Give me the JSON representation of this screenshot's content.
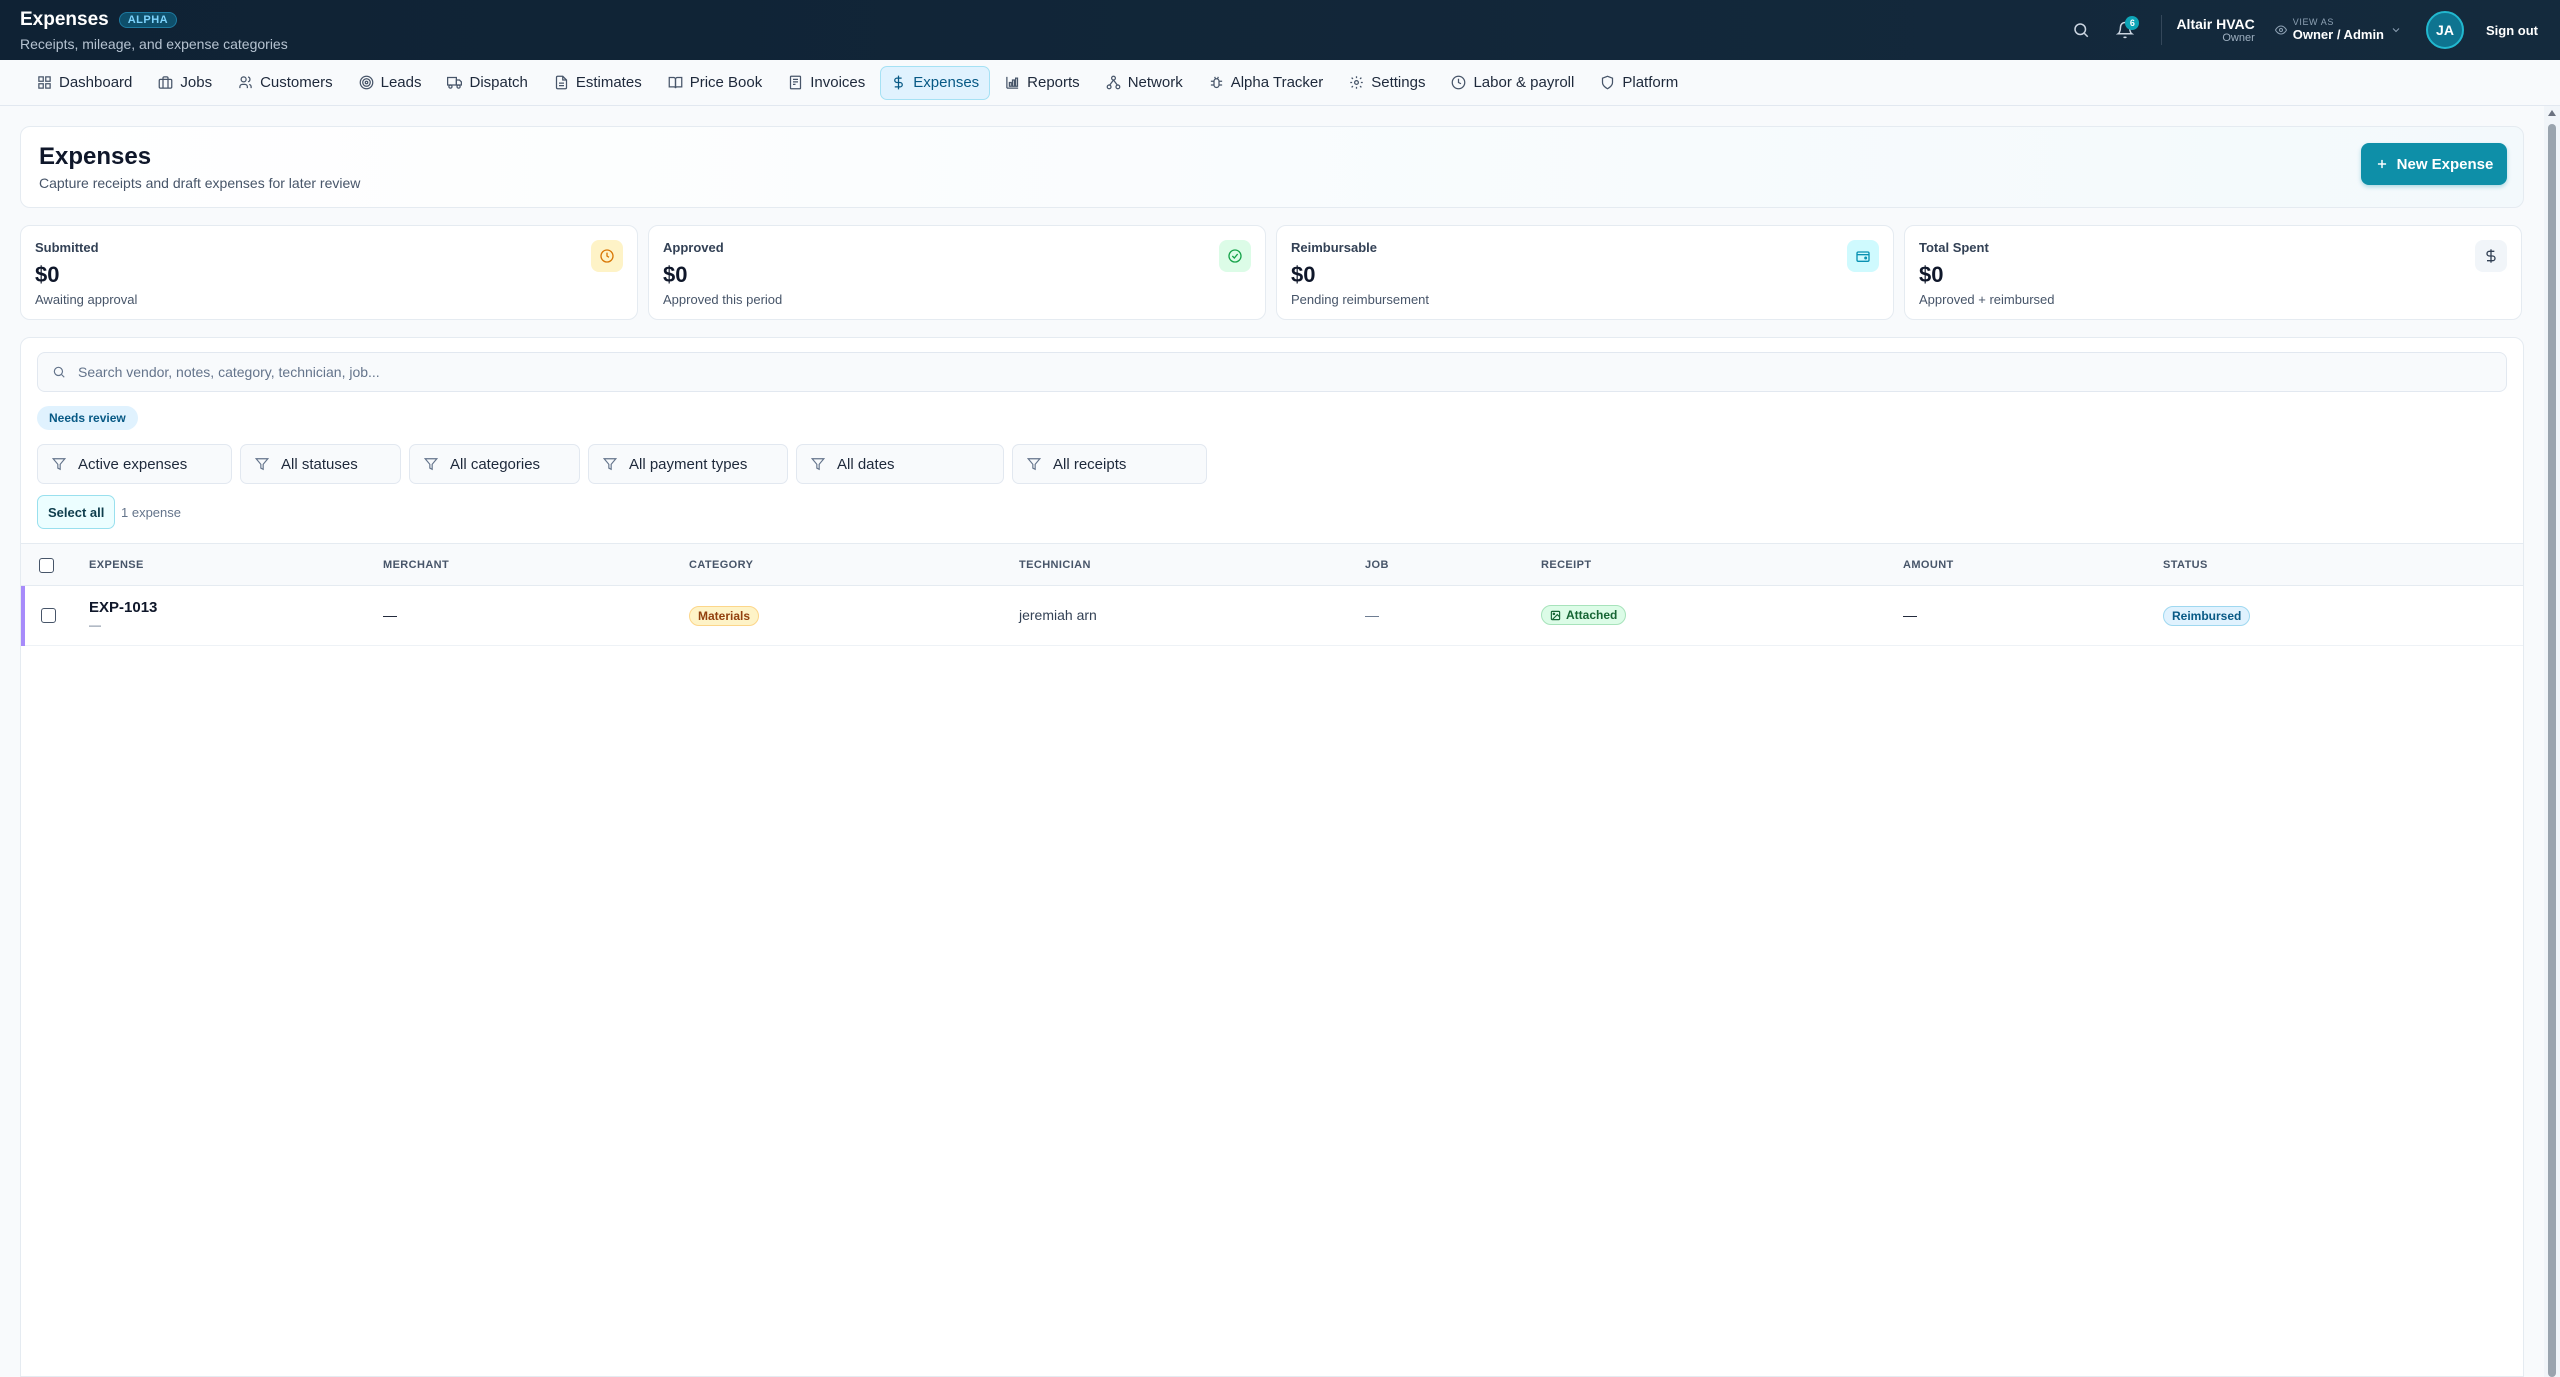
{
  "header": {
    "title": "Expenses",
    "badge": "ALPHA",
    "subtitle": "Receipts, mileage, and expense categories",
    "notifications_count": "6",
    "org_name": "Altair HVAC",
    "org_role": "Owner",
    "view_as_label": "VIEW AS",
    "view_as_value": "Owner / Admin",
    "avatar_initials": "JA",
    "signout_label": "Sign out"
  },
  "nav": {
    "items": [
      {
        "label": "Dashboard",
        "icon": "grid-icon"
      },
      {
        "label": "Jobs",
        "icon": "briefcase-icon"
      },
      {
        "label": "Customers",
        "icon": "users-icon"
      },
      {
        "label": "Leads",
        "icon": "target-icon"
      },
      {
        "label": "Dispatch",
        "icon": "truck-icon"
      },
      {
        "label": "Estimates",
        "icon": "file-icon"
      },
      {
        "label": "Price Book",
        "icon": "book-icon"
      },
      {
        "label": "Invoices",
        "icon": "receipt-icon"
      },
      {
        "label": "Expenses",
        "icon": "dollar-icon",
        "active": true
      },
      {
        "label": "Reports",
        "icon": "bar-chart-icon"
      },
      {
        "label": "Network",
        "icon": "network-icon"
      },
      {
        "label": "Alpha Tracker",
        "icon": "bug-icon"
      },
      {
        "label": "Settings",
        "icon": "gear-icon"
      },
      {
        "label": "Labor & payroll",
        "icon": "clock-icon"
      },
      {
        "label": "Platform",
        "icon": "shield-icon"
      }
    ]
  },
  "page": {
    "title": "Expenses",
    "subtitle": "Capture receipts and draft expenses for later review",
    "new_button": "New Expense"
  },
  "stats": [
    {
      "label": "Submitted",
      "value": "$0",
      "sub": "Awaiting approval",
      "icon": "clock-icon",
      "color": "#d97706",
      "bg": "#fef3c7"
    },
    {
      "label": "Approved",
      "value": "$0",
      "sub": "Approved this period",
      "icon": "check-circle-icon",
      "color": "#16a34a",
      "bg": "#dcfce7"
    },
    {
      "label": "Reimbursable",
      "value": "$0",
      "sub": "Pending reimbursement",
      "icon": "wallet-icon",
      "color": "#0891b2",
      "bg": "#cffafe"
    },
    {
      "label": "Total Spent",
      "value": "$0",
      "sub": "Approved + reimbursed",
      "icon": "dollar-icon",
      "color": "#334155",
      "bg": "#f1f5f9"
    }
  ],
  "search": {
    "placeholder": "Search vendor, notes, category, technician, job...",
    "value": ""
  },
  "needs_review": "Needs review",
  "filters": [
    "Active expenses",
    "All statuses",
    "All categories",
    "All payment types",
    "All dates",
    "All receipts"
  ],
  "select_all": "Select all",
  "count_text": "1 expense",
  "table": {
    "columns": [
      "EXPENSE",
      "MERCHANT",
      "CATEGORY",
      "TECHNICIAN",
      "JOB",
      "RECEIPT",
      "AMOUNT",
      "STATUS"
    ],
    "rows": [
      {
        "expense": "EXP-1013",
        "expense_sub": "—",
        "merchant": "—",
        "category": "Materials",
        "technician": "jeremiah arn",
        "job": "—",
        "receipt": "Attached",
        "amount": "—",
        "status": "Reimbursed"
      }
    ]
  }
}
